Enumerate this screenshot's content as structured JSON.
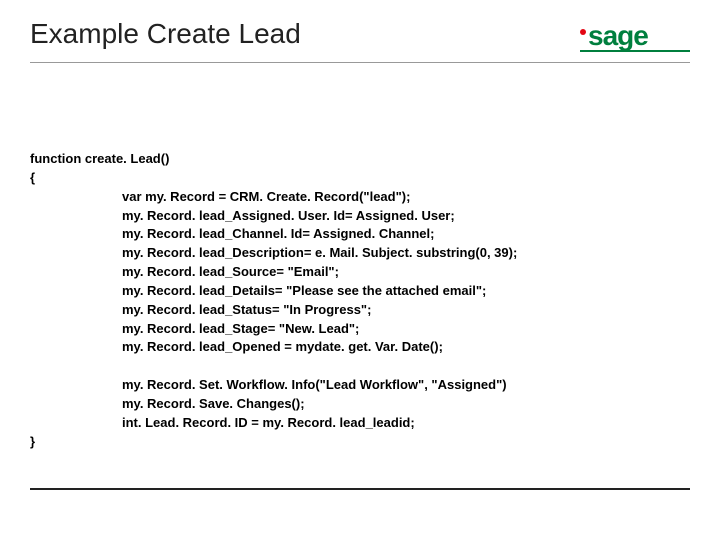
{
  "header": {
    "title": "Example Create Lead",
    "logo_text": "sage"
  },
  "code": {
    "decl": "function create. Lead()",
    "open": "{",
    "body1": [
      "var my. Record = CRM. Create. Record(\"lead\");",
      "my. Record. lead_Assigned. User. Id= Assigned. User;",
      "my. Record. lead_Channel. Id= Assigned. Channel;",
      "my. Record. lead_Description= e. Mail. Subject. substring(0, 39);",
      "my. Record. lead_Source= \"Email\";",
      "my. Record. lead_Details= \"Please see the attached email\";",
      "my. Record. lead_Status= \"In Progress\";",
      "my. Record. lead_Stage= \"New. Lead\";",
      "my. Record. lead_Opened = mydate. get. Var. Date();"
    ],
    "body2": [
      "my. Record. Set. Workflow. Info(\"Lead Workflow\", \"Assigned\")",
      "my. Record. Save. Changes();",
      "int. Lead. Record. ID = my. Record. lead_leadid;"
    ],
    "close": "}"
  }
}
